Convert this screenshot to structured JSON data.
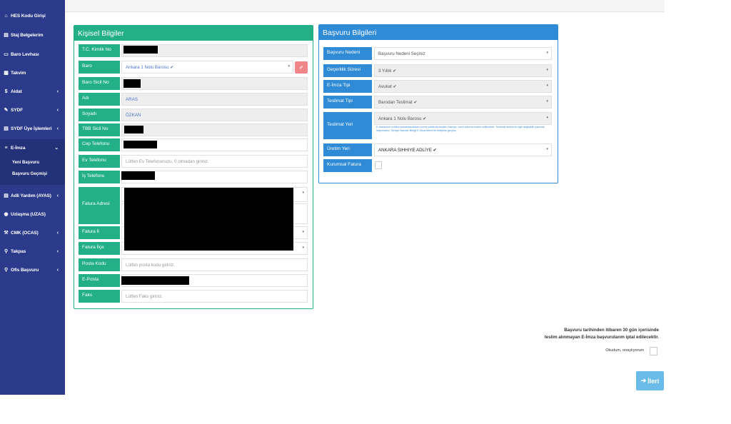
{
  "sidebar": {
    "items": [
      {
        "label": "HES Kodu Girişi",
        "icon": "house-person-icon"
      },
      {
        "label": "Staj Belgelerim",
        "icon": "document-icon"
      },
      {
        "label": "Baro Levhası",
        "icon": "card-icon"
      },
      {
        "label": "Takvim",
        "icon": "calendar-icon"
      },
      {
        "label": "Aidat",
        "icon": "coin-icon"
      },
      {
        "label": "SYDF",
        "icon": "pen-icon"
      },
      {
        "label": "SYDF Üye İşlemleri",
        "icon": "list-icon"
      },
      {
        "label": "E-İmza",
        "icon": "menu-icon"
      },
      {
        "label": "Adli Yardım (AYAS)",
        "icon": "document-icon"
      },
      {
        "label": "Uzlaşma (UZAS)",
        "icon": "eye-icon"
      },
      {
        "label": "CMK (OCAS)",
        "icon": "gavel-icon"
      },
      {
        "label": "Takpas",
        "icon": "search-icon"
      },
      {
        "label": "Ofis Başvuru",
        "icon": "search-icon"
      }
    ],
    "eimza_sub": [
      "Yeni Başvuru",
      "Başvuru Geçmişi"
    ]
  },
  "kisisel": {
    "title": "Kişisel Bilgiler",
    "labels": {
      "tc": "T.C. Kimlik No",
      "baro": "Baro",
      "baro_sicil": "Baro Sicil No",
      "adi": "Adı",
      "soyadi": "Soyadı",
      "tbb": "TBB Sicil No",
      "cep": "Cep Telefonu",
      "ev": "Ev Telefonu",
      "is": "İş Telefonu",
      "fatura_adres": "Fatura Adresi",
      "fatura_il": "Fatura İl",
      "fatura_ilce": "Fatura İlçe",
      "posta": "Posta Kodu",
      "eposta": "E-Posta",
      "faks": "Faks"
    },
    "values": {
      "baro": "Ankara 1 Nolu Barosu ✔",
      "adi": "ARAS",
      "soyadi": "ÖZKAN"
    },
    "placeholders": {
      "ev": "Lütfen Ev Telefonunuzu, 0 olmadan giriniz.",
      "posta": "Lütfen posta kodu giriniz.",
      "faks": "Lütfen Faks giriniz."
    }
  },
  "basvuru": {
    "title": "Başvuru Bilgileri",
    "labels": {
      "neden": "Başvuru Nedeni",
      "sure": "Geçerlilik Süresi",
      "tip": "E-İmza Tipi",
      "teslimat_tipi": "Teslimat Tipi",
      "teslimat_yeri": "Teslimat Yeri",
      "uretim": "Üretim Yeri",
      "kurumsal": "Kurumsal Fatura"
    },
    "values": {
      "neden": "Başvuru Nedeni Seçiniz",
      "sure": "3 Yıllık ✔",
      "tip": "Avukat ✔",
      "teslimat_tipi": "Barodan Teslimat ✔",
      "teslimat_yeri": "Ankara 1 Nolu Barosu ✔",
      "uretim": "ANKARA SIHHIYE ADLİYE ✔"
    },
    "teslimat_note": "E-imzanızın üretimi tamamlandıktan sonra yukarıda seçilen baroya, ücret adınıza teslim edilecektir. Teslimat adresi ile ilgili değişiklik yapmak istiyorsanız Türkiye Barolar Birliği E-İmza birimi ile iletişime geçiniz."
  },
  "footer": {
    "notice_line1": "Başvuru tarihinden itibaren 30 gün içerisinde",
    "notice_line2": "teslim alınmayan E-İmza başvurularım iptal edilecektir.",
    "confirm": "Okudum, onaylıyorum",
    "next": "İleri",
    "next_icon": "arrow-right-icon"
  },
  "colors": {
    "sidebar": "#2c3a8c",
    "green": "#23b088",
    "blue": "#2f8bd6",
    "danger": "#f0868a"
  }
}
